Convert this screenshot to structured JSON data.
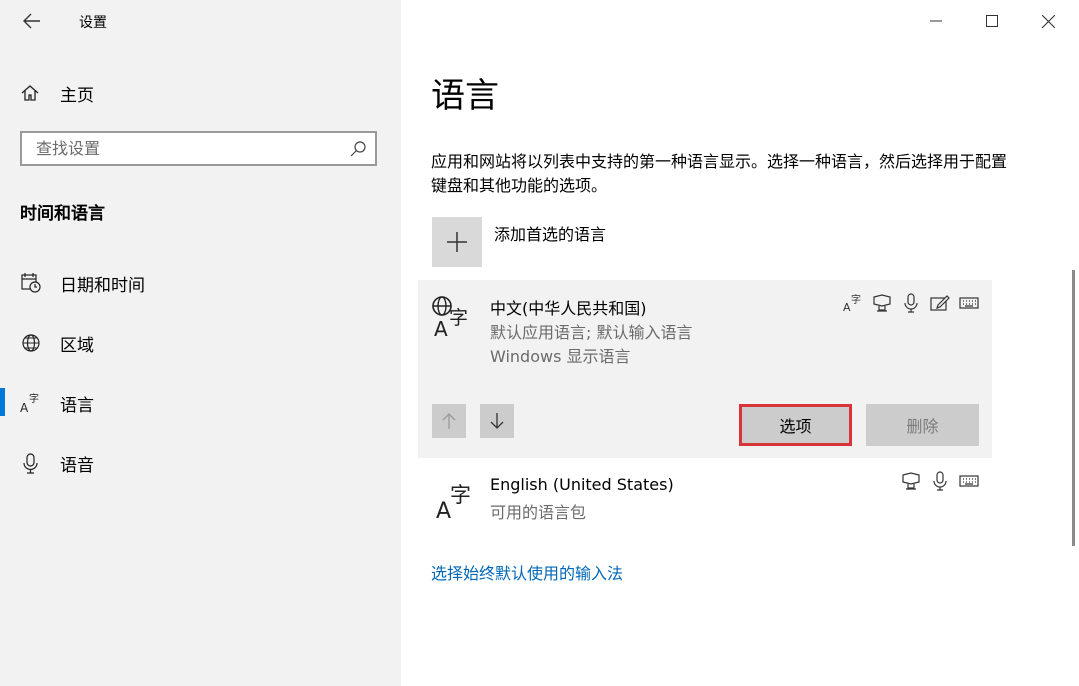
{
  "window": {
    "title": "设置",
    "back_icon": "back-arrow-icon",
    "controls": [
      "minimize-icon",
      "maximize-icon",
      "close-icon"
    ]
  },
  "sidebar": {
    "home_label": "主页",
    "search_placeholder": "查找设置",
    "section_title": "时间和语言",
    "items": [
      {
        "label": "日期和时间",
        "icon": "calendar-clock-icon",
        "active": false
      },
      {
        "label": "区域",
        "icon": "globe-region-icon",
        "active": false
      },
      {
        "label": "语言",
        "icon": "language-icon",
        "active": true
      },
      {
        "label": "语音",
        "icon": "microphone-icon",
        "active": false
      }
    ],
    "accent_color": "#0078d7"
  },
  "main": {
    "title": "语言",
    "description": "应用和网站将以列表中支持的第一种语言显示。选择一种语言，然后选择用于配置键盘和其他功能的选项。",
    "add_language_label": "添加首选的语言",
    "languages": [
      {
        "name": "中文(中华人民共和国)",
        "sub1": "默认应用语言; 默认输入语言",
        "sub2": "Windows 显示语言",
        "features": [
          "display-language-icon",
          "speech-icon",
          "microphone-icon",
          "handwriting-icon",
          "keyboard-icon"
        ],
        "options_label": "选项",
        "remove_label": "删除"
      },
      {
        "name": "English (United States)",
        "sub1": "可用的语言包",
        "features": [
          "speech-icon",
          "microphone-icon",
          "keyboard-icon"
        ]
      }
    ],
    "input_method_link": "选择始终默认使用的输入法",
    "link_color": "#0067b8",
    "highlight_color": "#d8353a"
  }
}
